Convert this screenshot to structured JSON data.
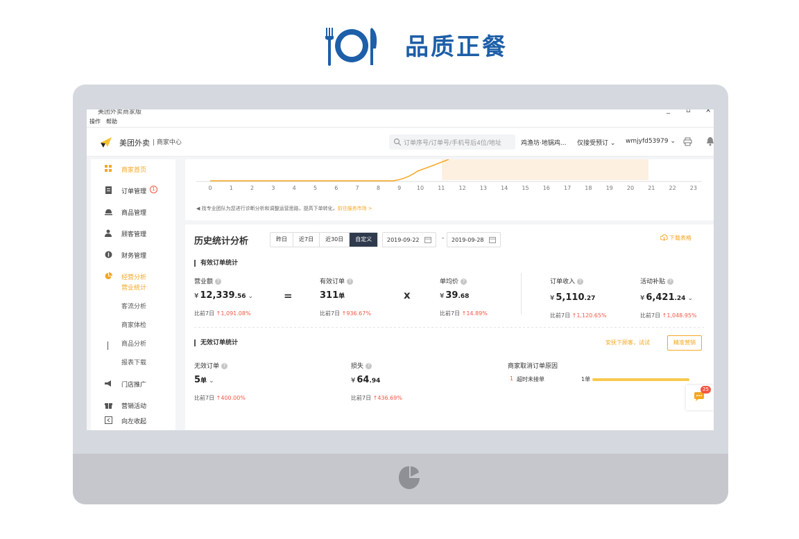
{
  "banner": {
    "title": "品质正餐"
  },
  "window": {
    "title": "美团外卖商家版",
    "menu": [
      "操作",
      "帮助"
    ]
  },
  "topbar": {
    "brand": "美团外卖",
    "brand_sub": "| 商家中心",
    "search_placeholder": "订单序号/订单号/手机号后4位/地址",
    "shop": "鸡渔坊·地锅鸡...",
    "accept_mode": "仅接受预订",
    "username": "wmjyfd53979"
  },
  "sidebar": {
    "items": [
      {
        "label": "商家首页",
        "icon": "grid-icon"
      },
      {
        "label": "订单管理",
        "icon": "order-icon",
        "badge": "1"
      },
      {
        "label": "商品管理",
        "icon": "dish-icon"
      },
      {
        "label": "顾客管理",
        "icon": "customer-icon"
      },
      {
        "label": "财务管理",
        "icon": "finance-icon"
      },
      {
        "label": "经营分析",
        "icon": "pie-icon"
      },
      {
        "label": "门店推广",
        "icon": "megaphone-icon"
      },
      {
        "label": "营销活动",
        "icon": "gift-icon"
      },
      {
        "label": "向左收起",
        "icon": "collapse-icon"
      }
    ],
    "subitems": [
      "营业统计",
      "客流分析",
      "商家体检",
      "商品分析",
      "报表下载"
    ]
  },
  "top_chart": {
    "x_ticks": [
      "0",
      "1",
      "2",
      "3",
      "4",
      "5",
      "6",
      "7",
      "8",
      "9",
      "10",
      "11",
      "12",
      "13",
      "14",
      "15",
      "16",
      "17",
      "18",
      "19",
      "20",
      "21",
      "22",
      "23"
    ],
    "tip": "找专业团队为您进行诊断分析和调整运营思路，提高下单转化，",
    "tip_link": "前往服务市场 >"
  },
  "history": {
    "title": "历史统计分析",
    "ranges": [
      "昨日",
      "近7日",
      "近30日",
      "自定义"
    ],
    "date_from": "2019-09-22",
    "date_to": "2019-09-28",
    "dash": "-",
    "download": "下载表格",
    "valid_title": "有效订单统计",
    "metrics": [
      {
        "label": "营业额",
        "cur": "¥",
        "value": "12,339",
        "decimal": ".56",
        "cmp": "比前7日",
        "arrow": "↑",
        "pct": "1,091.08%"
      },
      {
        "label": "有效订单",
        "cur": "",
        "value": "311",
        "decimal": "单",
        "cmp": "比前7日",
        "arrow": "↑",
        "pct": "936.67%"
      },
      {
        "label": "单均价",
        "cur": "¥",
        "value": "39",
        "decimal": ".68",
        "cmp": "比前7日",
        "arrow": "↑",
        "pct": "14.89%"
      },
      {
        "label": "订单收入",
        "cur": "¥",
        "value": "5,110",
        "decimal": ".27",
        "cmp": "比前7日",
        "arrow": "↑",
        "pct": "1,120.65%"
      },
      {
        "label": "活动补贴",
        "cur": "¥",
        "value": "6,421",
        "decimal": ".24",
        "cmp": "比前7日",
        "arrow": "↑",
        "pct": "1,048.95%"
      }
    ],
    "op_eq": "=",
    "op_x": "x",
    "invalid_title": "无效订单统计",
    "try_text": "安抚下顾客，试试",
    "precise_btn": "精准营销",
    "invalid_metrics": [
      {
        "label": "无效订单",
        "cur": "",
        "value": "5",
        "decimal": "单",
        "cmp": "比前7日",
        "arrow": "↑",
        "pct": "400.00%"
      },
      {
        "label": "损失",
        "cur": "¥",
        "value": "64",
        "decimal": ".94",
        "cmp": "比前7日",
        "arrow": "↑",
        "pct": "436.69%"
      }
    ],
    "reason_title": "商家取消订单原因",
    "reason": {
      "idx": "1",
      "text": "超时未接单",
      "count": "1单"
    }
  },
  "chat": {
    "badge": "25"
  },
  "colors": {
    "accent": "#f6a623",
    "up": "#f25643",
    "brand_blue": "#1d5fa8"
  }
}
